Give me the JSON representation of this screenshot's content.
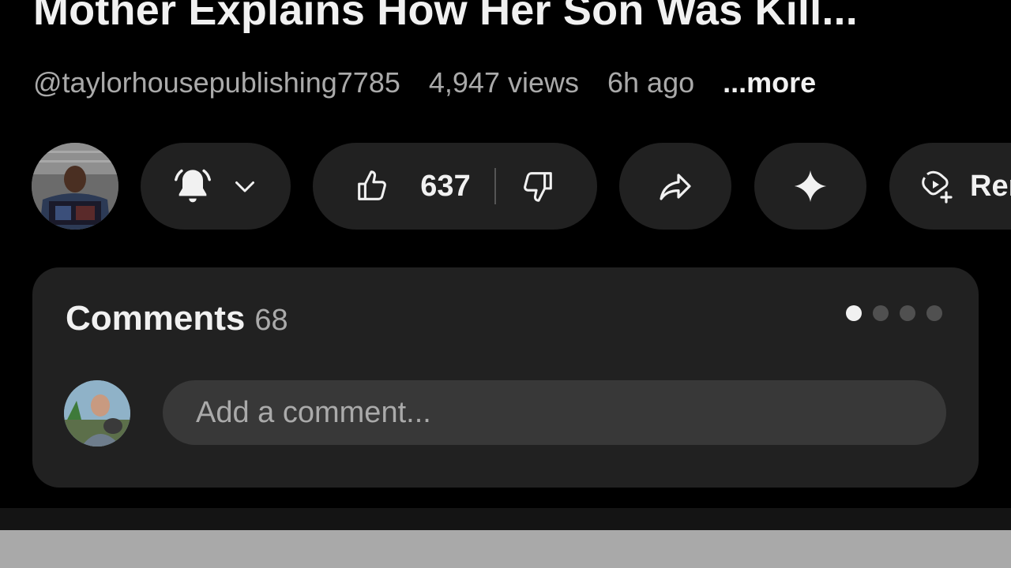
{
  "video": {
    "title": "Mother Explains How Her Son Was Kill...",
    "channel_handle": "@taylorhousepublishing7785",
    "views": "4,947 views",
    "age": "6h ago",
    "more_label": "...more"
  },
  "actions": {
    "subscribe_icon": "bell-icon",
    "dropdown_icon": "chevron-down-icon",
    "like_icon": "thumbs-up-icon",
    "like_count": "637",
    "dislike_icon": "thumbs-down-icon",
    "share_icon": "share-arrow-icon",
    "ask_icon": "sparkle-icon",
    "remix_icon": "remix-icon",
    "remix_label": "Remix"
  },
  "comments": {
    "title": "Comments",
    "count": "68",
    "placeholder": "Add a comment...",
    "pager_dots": 4,
    "active_dot": 0
  },
  "colors": {
    "background": "#000000",
    "pill": "#212121",
    "input": "#383838",
    "primary_text": "#f1f1f1",
    "secondary_text": "#aaaaaa"
  }
}
